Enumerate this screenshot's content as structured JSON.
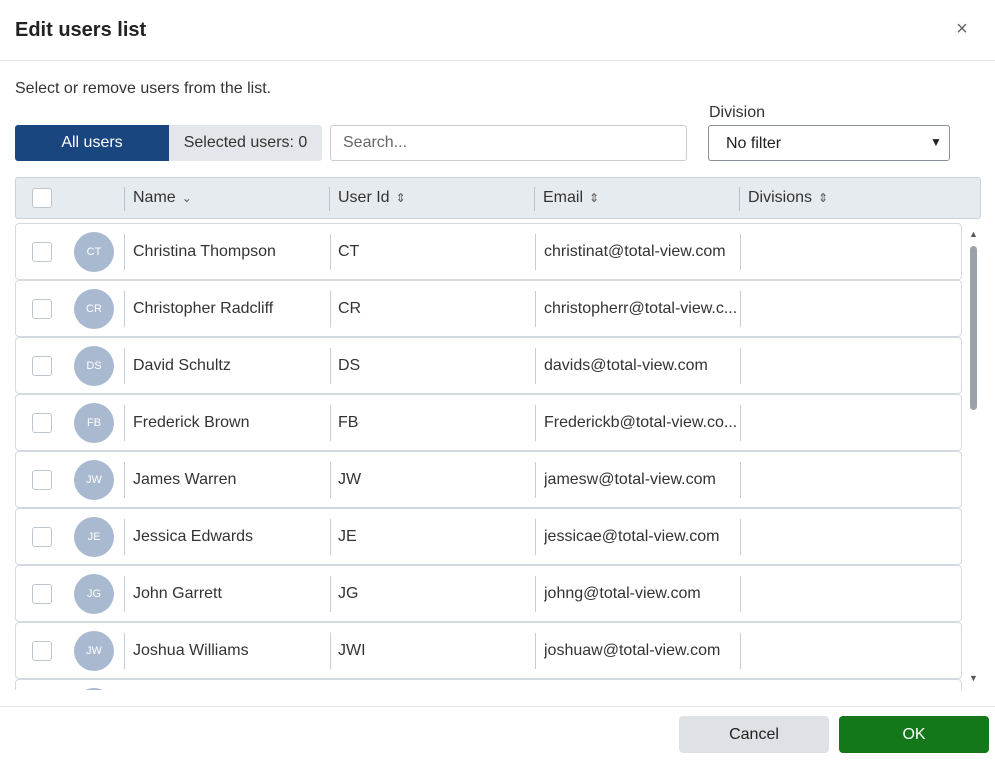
{
  "dialog": {
    "title": "Edit users list",
    "close_label": "×",
    "subtitle": "Select or remove users from the list."
  },
  "toggle": {
    "all_label": "All users",
    "selected_label": "Selected users: 0"
  },
  "search": {
    "placeholder": "Search...",
    "value": ""
  },
  "division_filter": {
    "label": "Division",
    "value": "No filter",
    "caret": "▼"
  },
  "table": {
    "columns": [
      {
        "label": "Name",
        "sort_icon": "⌄"
      },
      {
        "label": "User Id",
        "sort_icon": "⇕"
      },
      {
        "label": "Email",
        "sort_icon": "⇕"
      },
      {
        "label": "Divisions",
        "sort_icon": "⇕"
      }
    ],
    "rows": [
      {
        "initials": "CT",
        "name": "Christina Thompson",
        "user_id": "CT",
        "email": "christinat@total-view.com",
        "divisions": ""
      },
      {
        "initials": "CR",
        "name": "Christopher Radcliff",
        "user_id": "CR",
        "email": "christopherr@total-view.c...",
        "divisions": ""
      },
      {
        "initials": "DS",
        "name": "David Schultz",
        "user_id": "DS",
        "email": "davids@total-view.com",
        "divisions": ""
      },
      {
        "initials": "FB",
        "name": "Frederick Brown",
        "user_id": "FB",
        "email": "Frederickb@total-view.co...",
        "divisions": ""
      },
      {
        "initials": "JW",
        "name": "James Warren",
        "user_id": "JW",
        "email": "jamesw@total-view.com",
        "divisions": ""
      },
      {
        "initials": "JE",
        "name": "Jessica Edwards",
        "user_id": "JE",
        "email": "jessicae@total-view.com",
        "divisions": ""
      },
      {
        "initials": "JG",
        "name": "John Garrett",
        "user_id": "JG",
        "email": "johng@total-view.com",
        "divisions": ""
      },
      {
        "initials": "JW",
        "name": "Joshua Williams",
        "user_id": "JWI",
        "email": "joshuaw@total-view.com",
        "divisions": ""
      }
    ]
  },
  "scrollbar": {
    "up_glyph": "▲",
    "down_glyph": "▼"
  },
  "footer": {
    "cancel_label": "Cancel",
    "ok_label": "OK"
  },
  "colors": {
    "primary": "#19467e",
    "ok_green": "#14781a",
    "avatar": "#a9b9cf"
  }
}
